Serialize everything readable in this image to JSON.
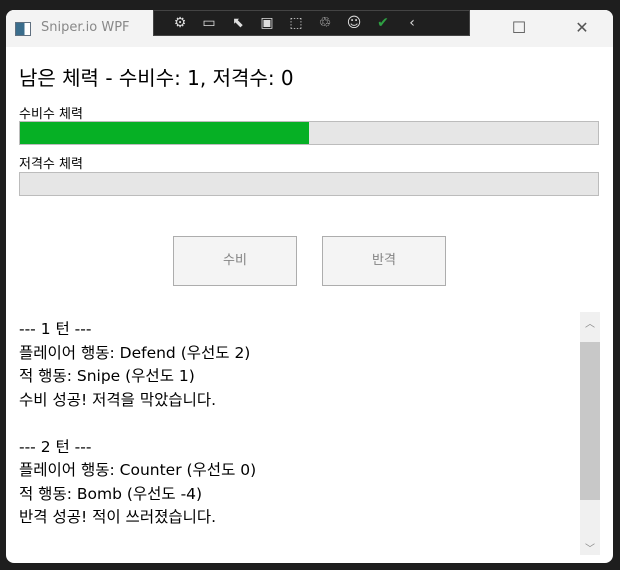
{
  "window": {
    "title": "Sniper.io WPF",
    "minimize": "—",
    "maximize": "☐",
    "close": "✕"
  },
  "debug_toolbar": {
    "icons": [
      "select-element-icon",
      "record-icon",
      "pointer-select-icon",
      "layout-adorner-icon",
      "track-focus-icon",
      "hot-reload-icon",
      "accessibility-icon",
      "check-icon",
      "collapse-icon"
    ]
  },
  "heading": "남은 체력 - 수비수: 1, 저격수: 0",
  "defender": {
    "label": "수비수 체력",
    "progress": 0.5,
    "color": "#06b025"
  },
  "sniper": {
    "label": "저격수 체력",
    "progress": 0.0
  },
  "buttons": {
    "defend": "수비",
    "counter": "반격"
  },
  "log": [
    "--- 1 턴 ---",
    "플레이어 행동: Defend (우선도 2)",
    "적 행동: Snipe (우선도 1)",
    "수비 성공! 저격을 막았습니다.",
    "",
    "--- 2 턴 ---",
    "플레이어 행동: Counter (우선도 0)",
    "적 행동: Bomb (우선도 -4)",
    "반격 성공! 적이 쓰러졌습니다."
  ]
}
